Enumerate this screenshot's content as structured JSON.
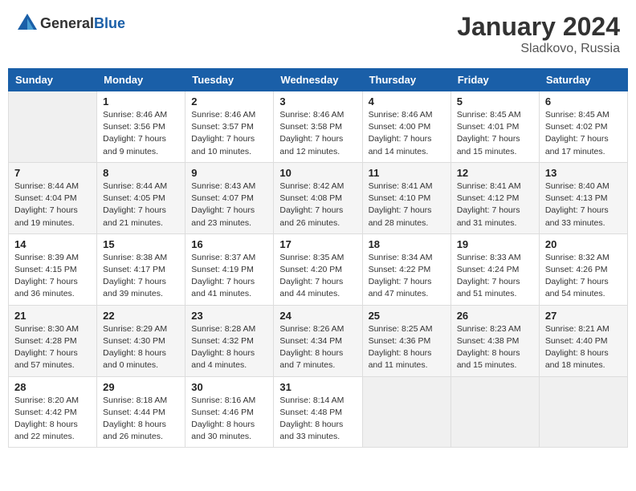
{
  "header": {
    "logo_general": "General",
    "logo_blue": "Blue",
    "title": "January 2024",
    "subtitle": "Sladkovo, Russia"
  },
  "weekdays": [
    "Sunday",
    "Monday",
    "Tuesday",
    "Wednesday",
    "Thursday",
    "Friday",
    "Saturday"
  ],
  "weeks": [
    [
      {
        "day": "",
        "info": ""
      },
      {
        "day": "1",
        "info": "Sunrise: 8:46 AM\nSunset: 3:56 PM\nDaylight: 7 hours\nand 9 minutes."
      },
      {
        "day": "2",
        "info": "Sunrise: 8:46 AM\nSunset: 3:57 PM\nDaylight: 7 hours\nand 10 minutes."
      },
      {
        "day": "3",
        "info": "Sunrise: 8:46 AM\nSunset: 3:58 PM\nDaylight: 7 hours\nand 12 minutes."
      },
      {
        "day": "4",
        "info": "Sunrise: 8:46 AM\nSunset: 4:00 PM\nDaylight: 7 hours\nand 14 minutes."
      },
      {
        "day": "5",
        "info": "Sunrise: 8:45 AM\nSunset: 4:01 PM\nDaylight: 7 hours\nand 15 minutes."
      },
      {
        "day": "6",
        "info": "Sunrise: 8:45 AM\nSunset: 4:02 PM\nDaylight: 7 hours\nand 17 minutes."
      }
    ],
    [
      {
        "day": "7",
        "info": "Sunrise: 8:44 AM\nSunset: 4:04 PM\nDaylight: 7 hours\nand 19 minutes."
      },
      {
        "day": "8",
        "info": "Sunrise: 8:44 AM\nSunset: 4:05 PM\nDaylight: 7 hours\nand 21 minutes."
      },
      {
        "day": "9",
        "info": "Sunrise: 8:43 AM\nSunset: 4:07 PM\nDaylight: 7 hours\nand 23 minutes."
      },
      {
        "day": "10",
        "info": "Sunrise: 8:42 AM\nSunset: 4:08 PM\nDaylight: 7 hours\nand 26 minutes."
      },
      {
        "day": "11",
        "info": "Sunrise: 8:41 AM\nSunset: 4:10 PM\nDaylight: 7 hours\nand 28 minutes."
      },
      {
        "day": "12",
        "info": "Sunrise: 8:41 AM\nSunset: 4:12 PM\nDaylight: 7 hours\nand 31 minutes."
      },
      {
        "day": "13",
        "info": "Sunrise: 8:40 AM\nSunset: 4:13 PM\nDaylight: 7 hours\nand 33 minutes."
      }
    ],
    [
      {
        "day": "14",
        "info": "Sunrise: 8:39 AM\nSunset: 4:15 PM\nDaylight: 7 hours\nand 36 minutes."
      },
      {
        "day": "15",
        "info": "Sunrise: 8:38 AM\nSunset: 4:17 PM\nDaylight: 7 hours\nand 39 minutes."
      },
      {
        "day": "16",
        "info": "Sunrise: 8:37 AM\nSunset: 4:19 PM\nDaylight: 7 hours\nand 41 minutes."
      },
      {
        "day": "17",
        "info": "Sunrise: 8:35 AM\nSunset: 4:20 PM\nDaylight: 7 hours\nand 44 minutes."
      },
      {
        "day": "18",
        "info": "Sunrise: 8:34 AM\nSunset: 4:22 PM\nDaylight: 7 hours\nand 47 minutes."
      },
      {
        "day": "19",
        "info": "Sunrise: 8:33 AM\nSunset: 4:24 PM\nDaylight: 7 hours\nand 51 minutes."
      },
      {
        "day": "20",
        "info": "Sunrise: 8:32 AM\nSunset: 4:26 PM\nDaylight: 7 hours\nand 54 minutes."
      }
    ],
    [
      {
        "day": "21",
        "info": "Sunrise: 8:30 AM\nSunset: 4:28 PM\nDaylight: 7 hours\nand 57 minutes."
      },
      {
        "day": "22",
        "info": "Sunrise: 8:29 AM\nSunset: 4:30 PM\nDaylight: 8 hours\nand 0 minutes."
      },
      {
        "day": "23",
        "info": "Sunrise: 8:28 AM\nSunset: 4:32 PM\nDaylight: 8 hours\nand 4 minutes."
      },
      {
        "day": "24",
        "info": "Sunrise: 8:26 AM\nSunset: 4:34 PM\nDaylight: 8 hours\nand 7 minutes."
      },
      {
        "day": "25",
        "info": "Sunrise: 8:25 AM\nSunset: 4:36 PM\nDaylight: 8 hours\nand 11 minutes."
      },
      {
        "day": "26",
        "info": "Sunrise: 8:23 AM\nSunset: 4:38 PM\nDaylight: 8 hours\nand 15 minutes."
      },
      {
        "day": "27",
        "info": "Sunrise: 8:21 AM\nSunset: 4:40 PM\nDaylight: 8 hours\nand 18 minutes."
      }
    ],
    [
      {
        "day": "28",
        "info": "Sunrise: 8:20 AM\nSunset: 4:42 PM\nDaylight: 8 hours\nand 22 minutes."
      },
      {
        "day": "29",
        "info": "Sunrise: 8:18 AM\nSunset: 4:44 PM\nDaylight: 8 hours\nand 26 minutes."
      },
      {
        "day": "30",
        "info": "Sunrise: 8:16 AM\nSunset: 4:46 PM\nDaylight: 8 hours\nand 30 minutes."
      },
      {
        "day": "31",
        "info": "Sunrise: 8:14 AM\nSunset: 4:48 PM\nDaylight: 8 hours\nand 33 minutes."
      },
      {
        "day": "",
        "info": ""
      },
      {
        "day": "",
        "info": ""
      },
      {
        "day": "",
        "info": ""
      }
    ]
  ]
}
